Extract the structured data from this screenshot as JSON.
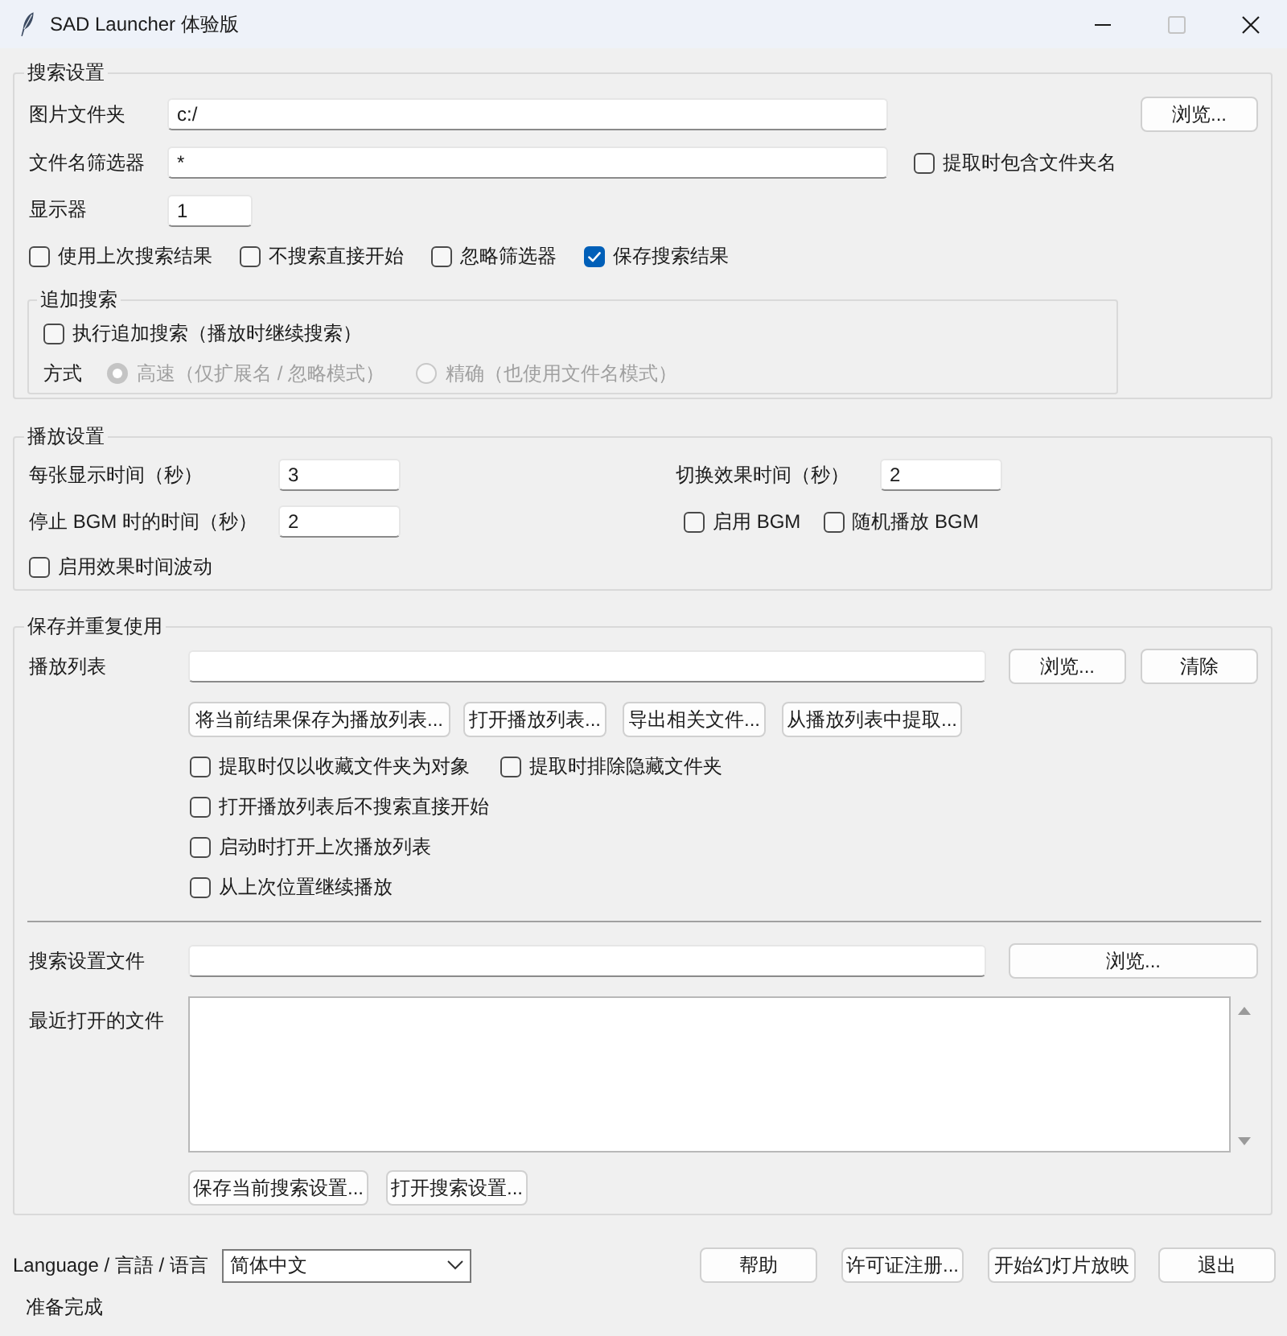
{
  "window": {
    "title": "SAD Launcher 体验版",
    "maximizable": false
  },
  "search_settings": {
    "title": "搜索设置",
    "image_folder": {
      "label": "图片文件夹",
      "value": "c:/",
      "button": "浏览..."
    },
    "filename_filter": {
      "label": "文件名筛选器",
      "value": "*",
      "include_folder_name": {
        "label": "提取时包含文件夹名",
        "checked": false
      }
    },
    "display": {
      "label": "显示器",
      "value": "1"
    },
    "options": [
      {
        "label": "使用上次搜索结果",
        "checked": false
      },
      {
        "label": "不搜索直接开始",
        "checked": false
      },
      {
        "label": "忽略筛选器",
        "checked": false
      },
      {
        "label": "保存搜索结果",
        "checked": true
      }
    ],
    "additional_search": {
      "title": "追加搜索",
      "enable": {
        "label": "执行追加搜索（播放时继续搜索）",
        "checked": false
      },
      "mode_label": "方式",
      "modes": [
        {
          "label": "高速（仅扩展名 / 忽略模式）",
          "selected": true,
          "disabled": true
        },
        {
          "label": "精确（也使用文件名模式）",
          "selected": false,
          "disabled": true
        }
      ]
    }
  },
  "playback_settings": {
    "title": "播放设置",
    "display_time": {
      "label": "每张显示时间（秒）",
      "value": "3"
    },
    "transition_time": {
      "label": "切换效果时间（秒）",
      "value": "2"
    },
    "bgm_stop_time": {
      "label": "停止 BGM 时的时间（秒）",
      "value": "2"
    },
    "bgm_options": [
      {
        "label": "启用 BGM",
        "checked": false
      },
      {
        "label": "随机播放 BGM",
        "checked": false
      }
    ],
    "effect_time_fluctuation": {
      "label": "启用效果时间波动",
      "checked": false
    }
  },
  "save_and_reuse": {
    "title": "保存并重复使用",
    "playlist": {
      "label": "播放列表",
      "buttons": [
        "浏览...",
        "清除"
      ]
    },
    "playlist_actions": [
      "将当前结果保存为播放列表...",
      "打开播放列表...",
      "导出相关文件...",
      "从播放列表中提取..."
    ],
    "extract_options": [
      {
        "label": "提取时仅以收藏文件夹为对象",
        "checked": false
      },
      {
        "label": "提取时排除隐藏文件夹",
        "checked": false
      }
    ],
    "playlist_options": [
      {
        "label": "打开播放列表后不搜索直接开始",
        "checked": false
      },
      {
        "label": "启动时打开上次播放列表",
        "checked": false
      },
      {
        "label": "从上次位置继续播放",
        "checked": false
      }
    ],
    "search_settings_file": {
      "label": "搜索设置文件",
      "button": "浏览..."
    },
    "recent_files": {
      "label": "最近打开的文件"
    },
    "settings_actions": [
      "保存当前搜索设置...",
      "打开搜索设置..."
    ]
  },
  "language": {
    "label": "Language / 言語 / 语言",
    "value": "简体中文"
  },
  "actions": [
    "帮助",
    "许可证注册...",
    "开始幻灯片放映",
    "退出"
  ],
  "status_bar": {
    "text": "准备完成"
  }
}
